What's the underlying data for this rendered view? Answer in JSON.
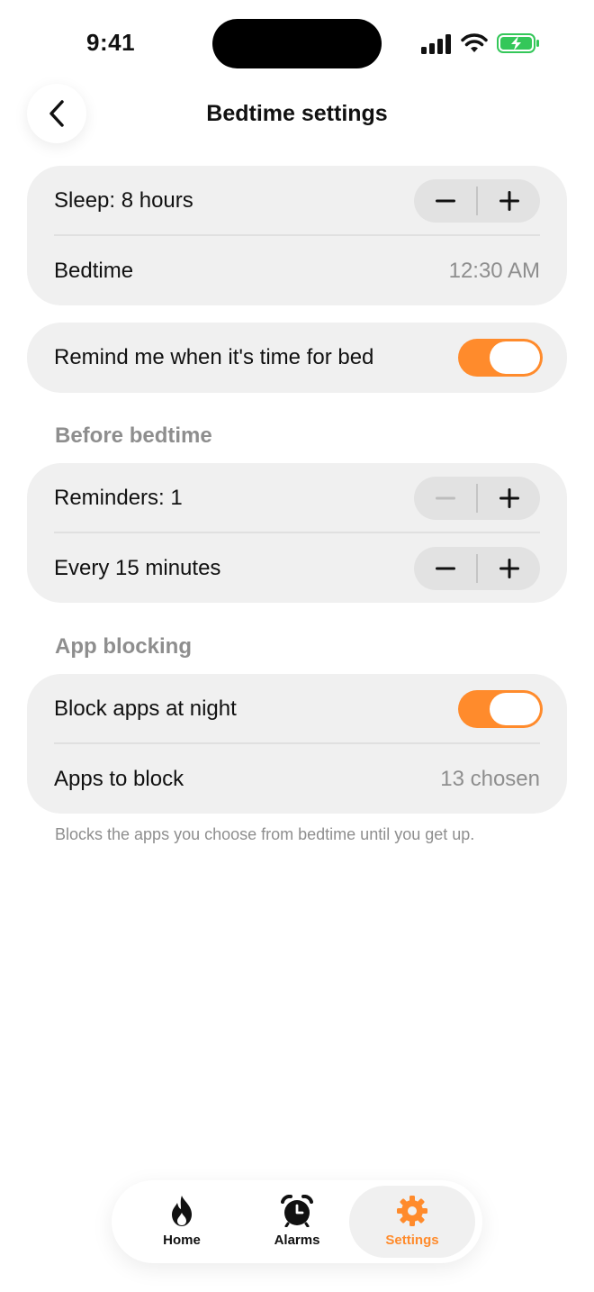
{
  "status_bar": {
    "time": "9:41"
  },
  "header": {
    "title": "Bedtime settings"
  },
  "sleep_card": {
    "sleep_label": "Sleep: 8 hours",
    "bedtime_label": "Bedtime",
    "bedtime_value": "12:30 AM"
  },
  "remind_card": {
    "label": "Remind me when it's time for bed",
    "enabled": true
  },
  "before_bedtime": {
    "header": "Before bedtime",
    "reminders_label": "Reminders: 1",
    "interval_label": "Every 15 minutes"
  },
  "app_blocking": {
    "header": "App blocking",
    "block_label": "Block apps at night",
    "block_enabled": true,
    "apps_label": "Apps to block",
    "apps_value": "13 chosen",
    "note": "Blocks the apps you choose from bedtime until you get up."
  },
  "tabbar": {
    "tabs": [
      {
        "label": "Home",
        "icon": "flame-icon"
      },
      {
        "label": "Alarms",
        "icon": "alarm-clock-icon"
      },
      {
        "label": "Settings",
        "icon": "gear-icon",
        "active": true
      }
    ]
  },
  "colors": {
    "accent": "#ff8b2c",
    "card": "#f0f0f0",
    "muted": "#8e8e8e"
  }
}
